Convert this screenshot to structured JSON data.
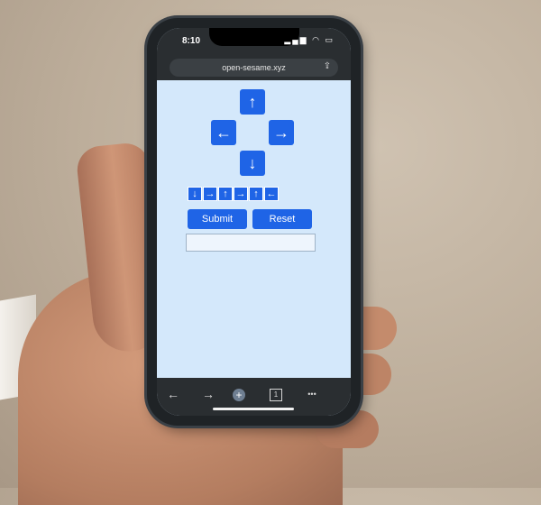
{
  "status": {
    "time": "8:10",
    "signal": "▂▄▆",
    "wifi": "◠",
    "battery": "▭"
  },
  "browser": {
    "url": "open-sesame.xyz",
    "share_icon": "share-icon"
  },
  "directions": {
    "up": "↑",
    "left": "←",
    "right": "→",
    "down": "↓"
  },
  "sequence": [
    "↓",
    "→",
    "↑",
    "→",
    "↑",
    "←"
  ],
  "actions": {
    "submit": "Submit",
    "reset": "Reset"
  },
  "input": {
    "value": "",
    "placeholder": ""
  },
  "toolbar": {
    "back": "←",
    "forward": "→",
    "new_tab": "+",
    "tabs": "1",
    "more": "•••"
  },
  "colors": {
    "accent": "#1f64e6",
    "page_bg": "#d4e8fb",
    "chrome": "#2a2e31"
  }
}
